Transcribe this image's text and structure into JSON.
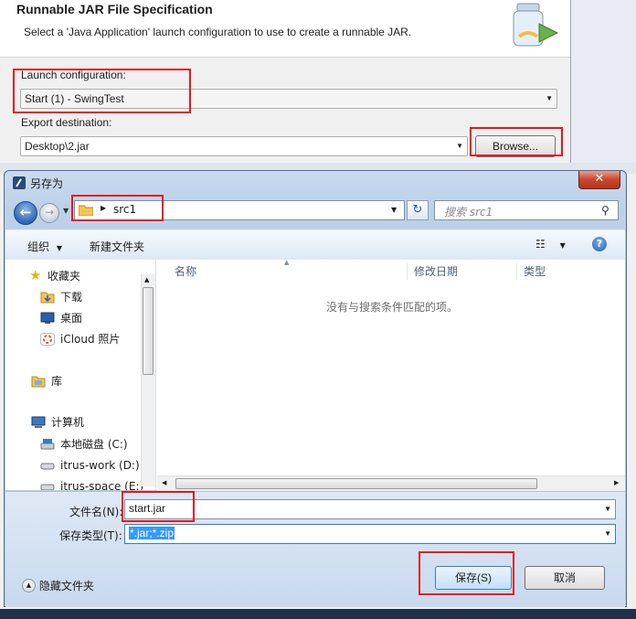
{
  "wizard": {
    "title": "Runnable JAR File Specification",
    "description": "Select a 'Java Application' launch configuration to use to create a runnable JAR.",
    "launch_label": "Launch configuration:",
    "launch_value": "Start (1) - SwingTest",
    "export_label": "Export destination:",
    "export_value": "Desktop\\2.jar",
    "browse_label": "Browse..."
  },
  "dialog": {
    "title": "另存为",
    "close_label": "✕",
    "address": {
      "current": "src1"
    },
    "search_placeholder": "搜索 src1",
    "toolbar": {
      "organize": "组织",
      "new_folder": "新建文件夹"
    },
    "nav": {
      "favorites": "收藏夹",
      "items": [
        "下载",
        "桌面",
        "iCloud 照片"
      ],
      "library": "库",
      "computer": "计算机",
      "drives": [
        "本地磁盘 (C:)",
        "itrus-work (D:)",
        "itrus-space (E:)"
      ]
    },
    "columns": [
      "名称",
      "修改日期",
      "类型"
    ],
    "empty_message": "没有与搜索条件匹配的项。",
    "filename_label": "文件名(N):",
    "filename_value": "start.jar",
    "filetype_label": "保存类型(T):",
    "filetype_value": "*.jar;*.zip",
    "hide_folders": "隐藏文件夹",
    "save_label": "保存(S)",
    "cancel_label": "取消"
  },
  "colors": {
    "highlight": "#e8141e",
    "accent": "#3399ff"
  }
}
